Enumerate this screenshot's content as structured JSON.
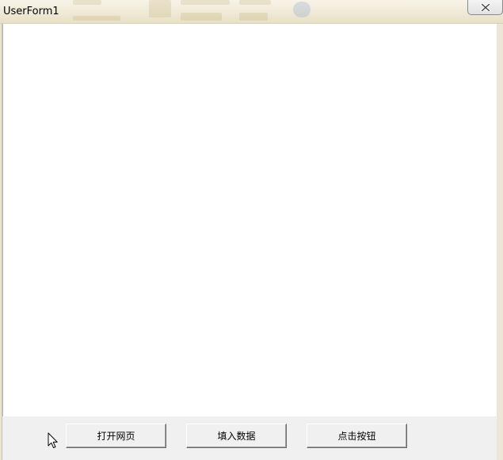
{
  "window": {
    "title": "UserForm1"
  },
  "buttons": {
    "open_webpage": "打开网页",
    "fill_data": "填入数据",
    "click_button": "点击按钮"
  },
  "icons": {
    "close": "close-icon",
    "cursor": "mouse-cursor-icon"
  }
}
